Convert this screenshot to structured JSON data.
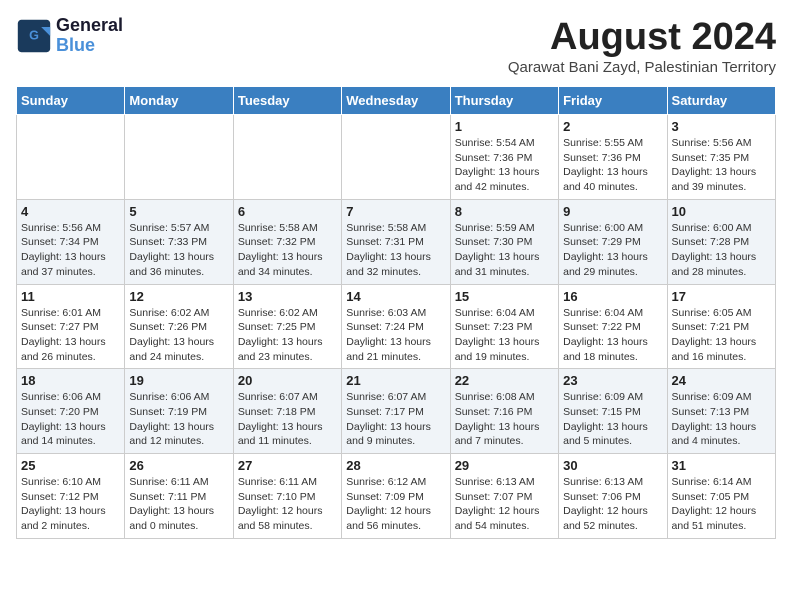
{
  "logo": {
    "line1": "General",
    "line2": "Blue"
  },
  "title": {
    "month_year": "August 2024",
    "location": "Qarawat Bani Zayd, Palestinian Territory"
  },
  "days_of_week": [
    "Sunday",
    "Monday",
    "Tuesday",
    "Wednesday",
    "Thursday",
    "Friday",
    "Saturday"
  ],
  "weeks": [
    [
      {
        "day": "",
        "info": ""
      },
      {
        "day": "",
        "info": ""
      },
      {
        "day": "",
        "info": ""
      },
      {
        "day": "",
        "info": ""
      },
      {
        "day": "1",
        "info": "Sunrise: 5:54 AM\nSunset: 7:36 PM\nDaylight: 13 hours\nand 42 minutes."
      },
      {
        "day": "2",
        "info": "Sunrise: 5:55 AM\nSunset: 7:36 PM\nDaylight: 13 hours\nand 40 minutes."
      },
      {
        "day": "3",
        "info": "Sunrise: 5:56 AM\nSunset: 7:35 PM\nDaylight: 13 hours\nand 39 minutes."
      }
    ],
    [
      {
        "day": "4",
        "info": "Sunrise: 5:56 AM\nSunset: 7:34 PM\nDaylight: 13 hours\nand 37 minutes."
      },
      {
        "day": "5",
        "info": "Sunrise: 5:57 AM\nSunset: 7:33 PM\nDaylight: 13 hours\nand 36 minutes."
      },
      {
        "day": "6",
        "info": "Sunrise: 5:58 AM\nSunset: 7:32 PM\nDaylight: 13 hours\nand 34 minutes."
      },
      {
        "day": "7",
        "info": "Sunrise: 5:58 AM\nSunset: 7:31 PM\nDaylight: 13 hours\nand 32 minutes."
      },
      {
        "day": "8",
        "info": "Sunrise: 5:59 AM\nSunset: 7:30 PM\nDaylight: 13 hours\nand 31 minutes."
      },
      {
        "day": "9",
        "info": "Sunrise: 6:00 AM\nSunset: 7:29 PM\nDaylight: 13 hours\nand 29 minutes."
      },
      {
        "day": "10",
        "info": "Sunrise: 6:00 AM\nSunset: 7:28 PM\nDaylight: 13 hours\nand 28 minutes."
      }
    ],
    [
      {
        "day": "11",
        "info": "Sunrise: 6:01 AM\nSunset: 7:27 PM\nDaylight: 13 hours\nand 26 minutes."
      },
      {
        "day": "12",
        "info": "Sunrise: 6:02 AM\nSunset: 7:26 PM\nDaylight: 13 hours\nand 24 minutes."
      },
      {
        "day": "13",
        "info": "Sunrise: 6:02 AM\nSunset: 7:25 PM\nDaylight: 13 hours\nand 23 minutes."
      },
      {
        "day": "14",
        "info": "Sunrise: 6:03 AM\nSunset: 7:24 PM\nDaylight: 13 hours\nand 21 minutes."
      },
      {
        "day": "15",
        "info": "Sunrise: 6:04 AM\nSunset: 7:23 PM\nDaylight: 13 hours\nand 19 minutes."
      },
      {
        "day": "16",
        "info": "Sunrise: 6:04 AM\nSunset: 7:22 PM\nDaylight: 13 hours\nand 18 minutes."
      },
      {
        "day": "17",
        "info": "Sunrise: 6:05 AM\nSunset: 7:21 PM\nDaylight: 13 hours\nand 16 minutes."
      }
    ],
    [
      {
        "day": "18",
        "info": "Sunrise: 6:06 AM\nSunset: 7:20 PM\nDaylight: 13 hours\nand 14 minutes."
      },
      {
        "day": "19",
        "info": "Sunrise: 6:06 AM\nSunset: 7:19 PM\nDaylight: 13 hours\nand 12 minutes."
      },
      {
        "day": "20",
        "info": "Sunrise: 6:07 AM\nSunset: 7:18 PM\nDaylight: 13 hours\nand 11 minutes."
      },
      {
        "day": "21",
        "info": "Sunrise: 6:07 AM\nSunset: 7:17 PM\nDaylight: 13 hours\nand 9 minutes."
      },
      {
        "day": "22",
        "info": "Sunrise: 6:08 AM\nSunset: 7:16 PM\nDaylight: 13 hours\nand 7 minutes."
      },
      {
        "day": "23",
        "info": "Sunrise: 6:09 AM\nSunset: 7:15 PM\nDaylight: 13 hours\nand 5 minutes."
      },
      {
        "day": "24",
        "info": "Sunrise: 6:09 AM\nSunset: 7:13 PM\nDaylight: 13 hours\nand 4 minutes."
      }
    ],
    [
      {
        "day": "25",
        "info": "Sunrise: 6:10 AM\nSunset: 7:12 PM\nDaylight: 13 hours\nand 2 minutes."
      },
      {
        "day": "26",
        "info": "Sunrise: 6:11 AM\nSunset: 7:11 PM\nDaylight: 13 hours\nand 0 minutes."
      },
      {
        "day": "27",
        "info": "Sunrise: 6:11 AM\nSunset: 7:10 PM\nDaylight: 12 hours\nand 58 minutes."
      },
      {
        "day": "28",
        "info": "Sunrise: 6:12 AM\nSunset: 7:09 PM\nDaylight: 12 hours\nand 56 minutes."
      },
      {
        "day": "29",
        "info": "Sunrise: 6:13 AM\nSunset: 7:07 PM\nDaylight: 12 hours\nand 54 minutes."
      },
      {
        "day": "30",
        "info": "Sunrise: 6:13 AM\nSunset: 7:06 PM\nDaylight: 12 hours\nand 52 minutes."
      },
      {
        "day": "31",
        "info": "Sunrise: 6:14 AM\nSunset: 7:05 PM\nDaylight: 12 hours\nand 51 minutes."
      }
    ]
  ]
}
